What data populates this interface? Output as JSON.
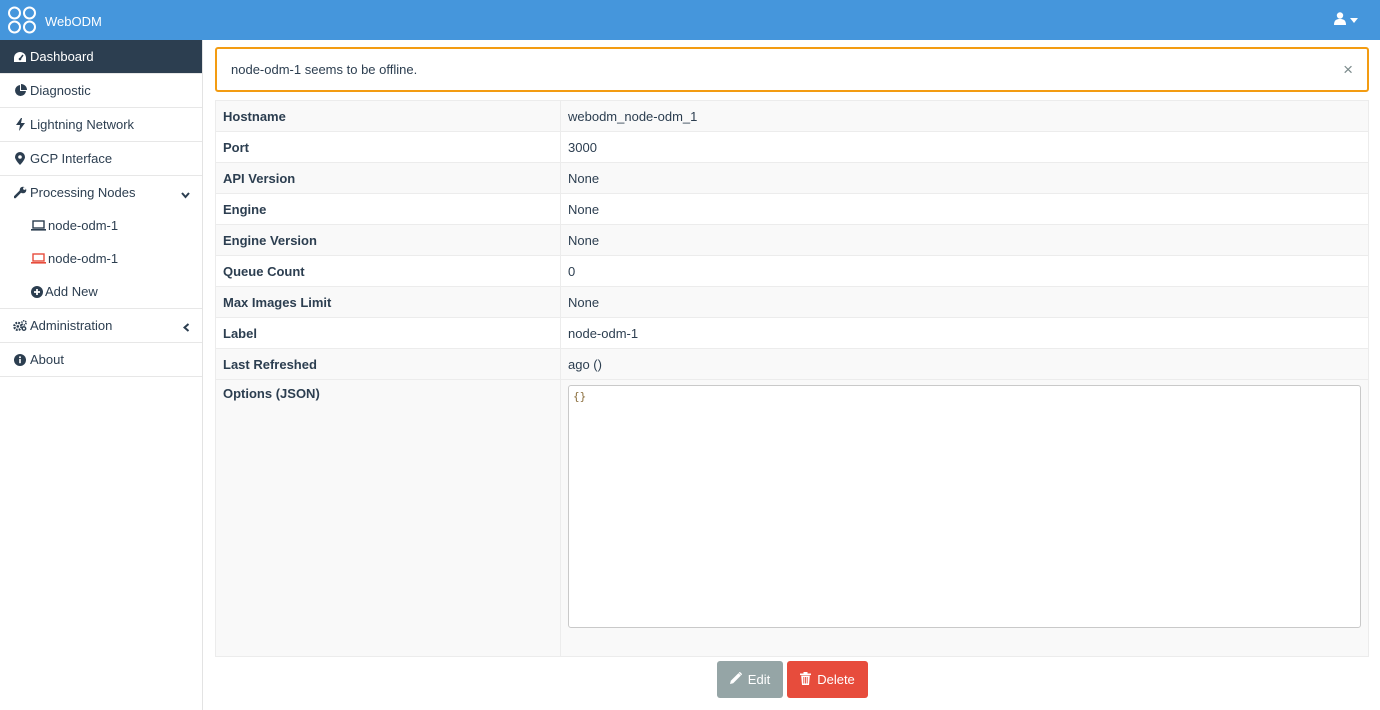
{
  "header": {
    "brand_name": "WebODM",
    "logo_icon": "webodm-logo-icon",
    "user_icon": "user-icon",
    "colors": {
      "bar": "#4596dc"
    }
  },
  "sidebar": {
    "items": [
      {
        "label": "Dashboard",
        "icon": "dashboard-icon",
        "active": true
      },
      {
        "label": "Diagnostic",
        "icon": "pie-chart-icon"
      },
      {
        "label": "Lightning Network",
        "icon": "bolt-icon"
      },
      {
        "label": "GCP Interface",
        "icon": "map-marker-icon"
      },
      {
        "label": "Processing Nodes",
        "icon": "wrench-icon",
        "expanded": true
      },
      {
        "label": "Administration",
        "icon": "gears-icon",
        "expanded": false
      },
      {
        "label": "About",
        "icon": "info-icon"
      }
    ],
    "processing_nodes": [
      {
        "label": "node-odm-1",
        "icon": "laptop-icon",
        "status": "online"
      },
      {
        "label": "node-odm-1",
        "icon": "laptop-icon",
        "status": "offline"
      },
      {
        "label": "Add New",
        "icon": "plus-circle-icon"
      }
    ]
  },
  "alert": {
    "message": "node-odm-1 seems to be offline.",
    "close_glyph": "×",
    "color": "#f39c12"
  },
  "node_info": {
    "rows": [
      {
        "key": "Hostname",
        "value": "webodm_node-odm_1"
      },
      {
        "key": "Port",
        "value": "3000"
      },
      {
        "key": "API Version",
        "value": "None"
      },
      {
        "key": "Engine",
        "value": "None"
      },
      {
        "key": "Engine Version",
        "value": "None"
      },
      {
        "key": "Queue Count",
        "value": "0"
      },
      {
        "key": "Max Images Limit",
        "value": "None"
      },
      {
        "key": "Label",
        "value": "node-odm-1"
      },
      {
        "key": "Last Refreshed",
        "value": "ago ()"
      }
    ],
    "options_label": "Options (JSON)",
    "options_value": "{}"
  },
  "actions": {
    "edit_label": "Edit",
    "delete_label": "Delete",
    "edit_color": "#95a5a6",
    "delete_color": "#e74c3c"
  }
}
